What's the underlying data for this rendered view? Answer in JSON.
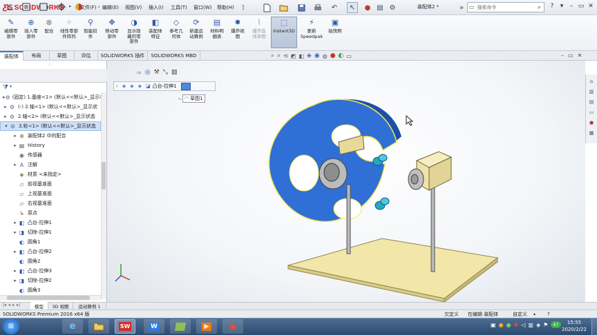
{
  "app": {
    "logo": "SOLIDWORKS",
    "doc_title": "装配体2 *"
  },
  "menu": [
    {
      "label": "文件(F)"
    },
    {
      "label": "编辑(E)"
    },
    {
      "label": "视图(V)"
    },
    {
      "label": "插入(I)"
    },
    {
      "label": "工具(T)"
    },
    {
      "label": "窗口(W)"
    },
    {
      "label": "帮助(H)"
    }
  ],
  "search": {
    "placeholder": "搜索命令"
  },
  "ribbon": [
    {
      "l1": "编辑零",
      "l2": "部件",
      "l3": ""
    },
    {
      "l1": "插入零",
      "l2": "部件",
      "l3": ""
    },
    {
      "l1": "配合",
      "l2": "",
      "l3": ""
    },
    {
      "l1": "线性零部",
      "l2": "件阵列",
      "l3": ""
    },
    {
      "l1": "智能扣",
      "l2": "件",
      "l3": ""
    },
    {
      "l1": "移动零",
      "l2": "部件",
      "l3": ""
    },
    {
      "l1": "显示隐",
      "l2": "藏的零",
      "l3": "部件"
    },
    {
      "l1": "装配体",
      "l2": "特征",
      "l3": ""
    },
    {
      "l1": "参考几",
      "l2": "何体",
      "l3": ""
    },
    {
      "l1": "新建运",
      "l2": "动算例",
      "l3": ""
    },
    {
      "l1": "材料明",
      "l2": "细表",
      "l3": ""
    },
    {
      "l1": "爆炸视",
      "l2": "图",
      "l3": ""
    },
    {
      "l1": "爆炸直",
      "l2": "线草图",
      "l3": ""
    },
    {
      "l1": "Instant3D",
      "l2": "",
      "l3": ""
    },
    {
      "l1": "更新",
      "l2": "Speedpak",
      "l3": ""
    },
    {
      "l1": "拍快照",
      "l2": "",
      "l3": ""
    }
  ],
  "tabs": [
    {
      "label": "装配体"
    },
    {
      "label": "布局"
    },
    {
      "label": "草图"
    },
    {
      "label": "评估"
    },
    {
      "label": "SOLIDWORKS 插件"
    },
    {
      "label": "SOLIDWORKS MBD"
    }
  ],
  "tree": [
    {
      "label": "(固定) 1.基座<1> (默认<<默认>_显示状",
      "exp": "▸"
    },
    {
      "label": "(-) 2.轴<1> (默认<<默认>_显示状",
      "exp": "▸"
    },
    {
      "label": "2.轴<2> (默认<<默认>_显示状态",
      "exp": "▸"
    },
    {
      "label": "3.轮<1> (默认<<默认>_显示状态",
      "exp": "▾"
    },
    {
      "label": "装配体2 中的配合",
      "exp": "▸"
    },
    {
      "label": "History",
      "exp": "▸"
    },
    {
      "label": "传感器",
      "exp": ""
    },
    {
      "label": "注解",
      "exp": "▸"
    },
    {
      "label": "材质 <未指定>",
      "exp": ""
    },
    {
      "label": "前视基准面",
      "exp": ""
    },
    {
      "label": "上视基准面",
      "exp": ""
    },
    {
      "label": "右视基准面",
      "exp": ""
    },
    {
      "label": "原点",
      "exp": ""
    },
    {
      "label": "凸台-拉伸1",
      "exp": "▸"
    },
    {
      "label": "切除-拉伸1",
      "exp": "▸"
    },
    {
      "label": "圆角1",
      "exp": ""
    },
    {
      "label": "凸台-拉伸2",
      "exp": "▸"
    },
    {
      "label": "圆角2",
      "exp": ""
    },
    {
      "label": "凸台-拉伸3",
      "exp": "▸"
    },
    {
      "label": "切除-拉伸2",
      "exp": "▸"
    },
    {
      "label": "圆角3",
      "exp": ""
    }
  ],
  "breadcrumb": {
    "item": "凸台-拉伸1",
    "sketch": "草图1"
  },
  "bottom_tabs": [
    {
      "label": "模型"
    },
    {
      "label": "3D 视图"
    },
    {
      "label": "运动算例 1"
    }
  ],
  "status": {
    "product": "SOLIDWORKS Premium 2016 x64 版",
    "state": "欠定义",
    "mode": "在编辑 装配体",
    "custom": "自定义"
  },
  "clock": {
    "time": "15:55",
    "date": "2020/2/22"
  },
  "tray": {
    "badge": "47"
  },
  "colors": {
    "part_blue": "#2f6fd6",
    "base_tan": "#f2e6a9",
    "ribbon_bg": "#eef1f5",
    "taskbar": "#2c4a6e"
  }
}
